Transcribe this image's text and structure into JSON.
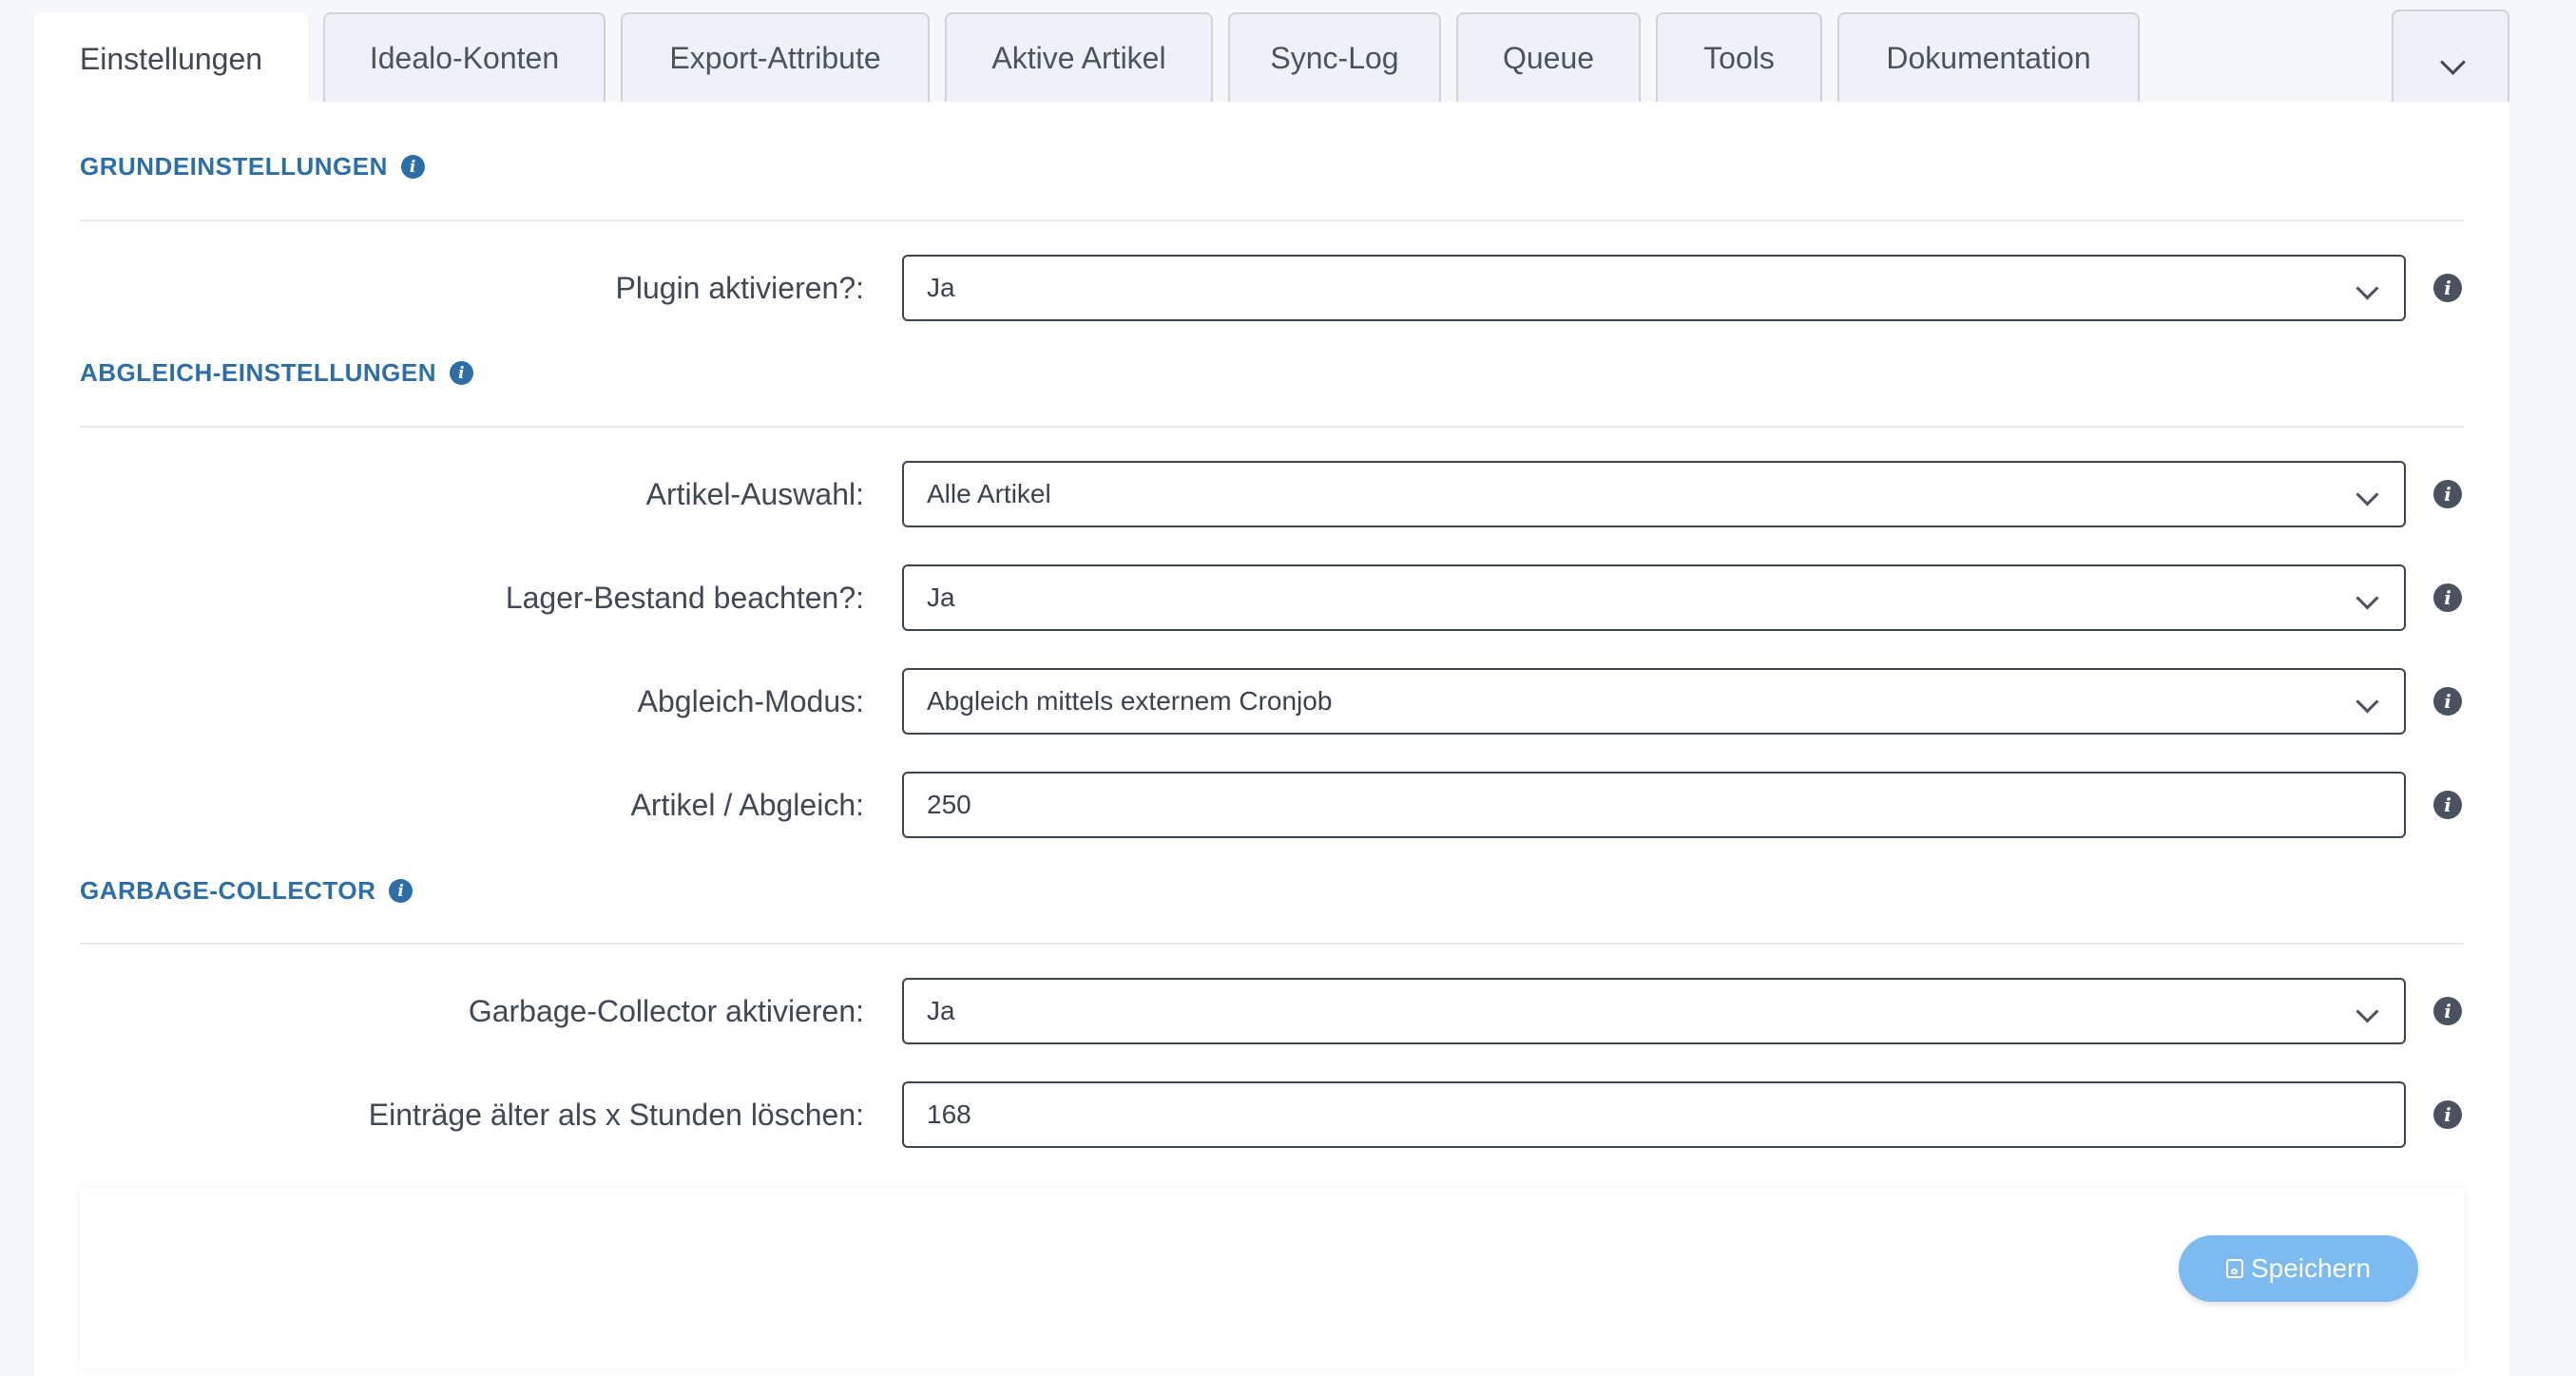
{
  "tabs": [
    {
      "label": "Einstellungen",
      "active": true
    },
    {
      "label": "Idealo-Konten"
    },
    {
      "label": "Export-Attribute"
    },
    {
      "label": "Aktive Artikel"
    },
    {
      "label": "Sync-Log"
    },
    {
      "label": "Queue"
    },
    {
      "label": "Tools"
    },
    {
      "label": "Dokumentation"
    }
  ],
  "sections": {
    "grund": {
      "title": "GRUNDEINSTELLUNGEN"
    },
    "abgleich": {
      "title": "ABGLEICH-EINSTELLUNGEN"
    },
    "garbage": {
      "title": "GARBAGE-COLLECTOR"
    }
  },
  "fields": {
    "plugin_aktivieren": {
      "label": "Plugin aktivieren?:",
      "value": "Ja"
    },
    "artikel_auswahl": {
      "label": "Artikel-Auswahl:",
      "value": "Alle Artikel"
    },
    "lager_bestand": {
      "label": "Lager-Bestand beachten?:",
      "value": "Ja"
    },
    "abgleich_modus": {
      "label": "Abgleich-Modus:",
      "value": "Abgleich mittels externem Cronjob"
    },
    "artikel_abgleich": {
      "label": "Artikel / Abgleich:",
      "value": "250"
    },
    "gc_aktivieren": {
      "label": "Garbage-Collector aktivieren:",
      "value": "Ja"
    },
    "eintraege_loeschen": {
      "label": "Einträge älter als x Stunden löschen:",
      "value": "168"
    }
  },
  "footer": {
    "save_label": "Speichern"
  },
  "colors": {
    "accent": "#2b6ea8",
    "button": "#7cbaf0"
  }
}
